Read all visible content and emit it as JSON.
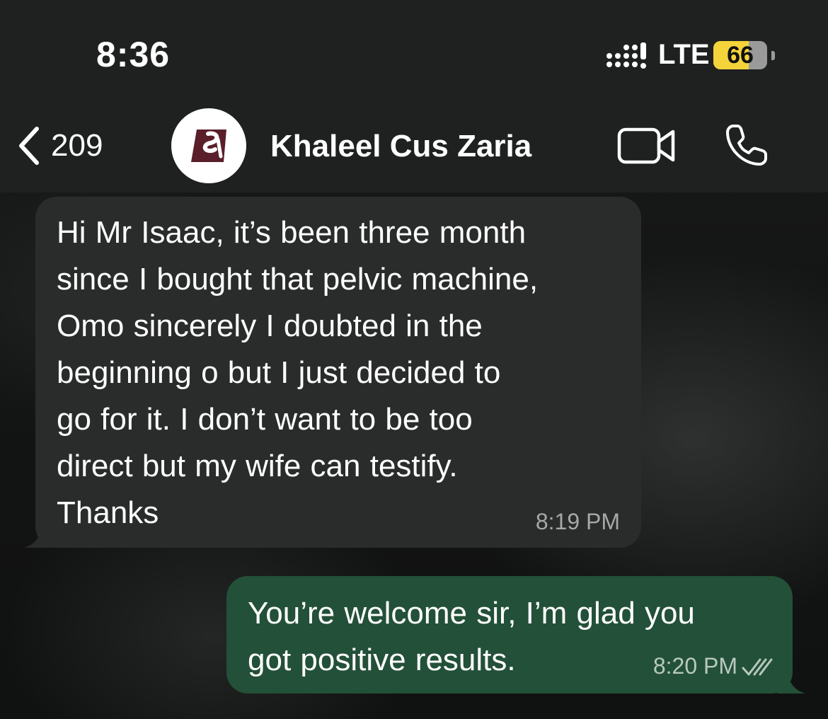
{
  "status_bar": {
    "time": "8:36",
    "network": "LTE",
    "battery": "66",
    "battery_level": 0.66
  },
  "header": {
    "back_count": "209",
    "contact_name": "Khaleel Cus Zaria"
  },
  "messages": [
    {
      "direction": "incoming",
      "text": "Hi Mr Isaac, it’s been three month\nsince I bought that pelvic machine,\nOmo sincerely I doubted in the\nbeginning o but I just decided to\ngo for it. I don’t want to be too\ndirect but my wife can testify.\nThanks",
      "time": "8:19 PM"
    },
    {
      "direction": "outgoing",
      "text": "You’re welcome sir, I’m glad you\ngot positive results.",
      "time": "8:20 PM",
      "status": "read"
    }
  ],
  "icons": {
    "back": "chevron-left-icon",
    "video": "video-camera-icon",
    "call": "phone-icon",
    "avatar": "logo-avatar",
    "read": "double-check-icon"
  },
  "colors": {
    "incoming_bubble": "#2a2b2b",
    "outgoing_bubble": "#235038",
    "header_bg": "#1f2121",
    "battery_accent": "#f5d33a"
  }
}
